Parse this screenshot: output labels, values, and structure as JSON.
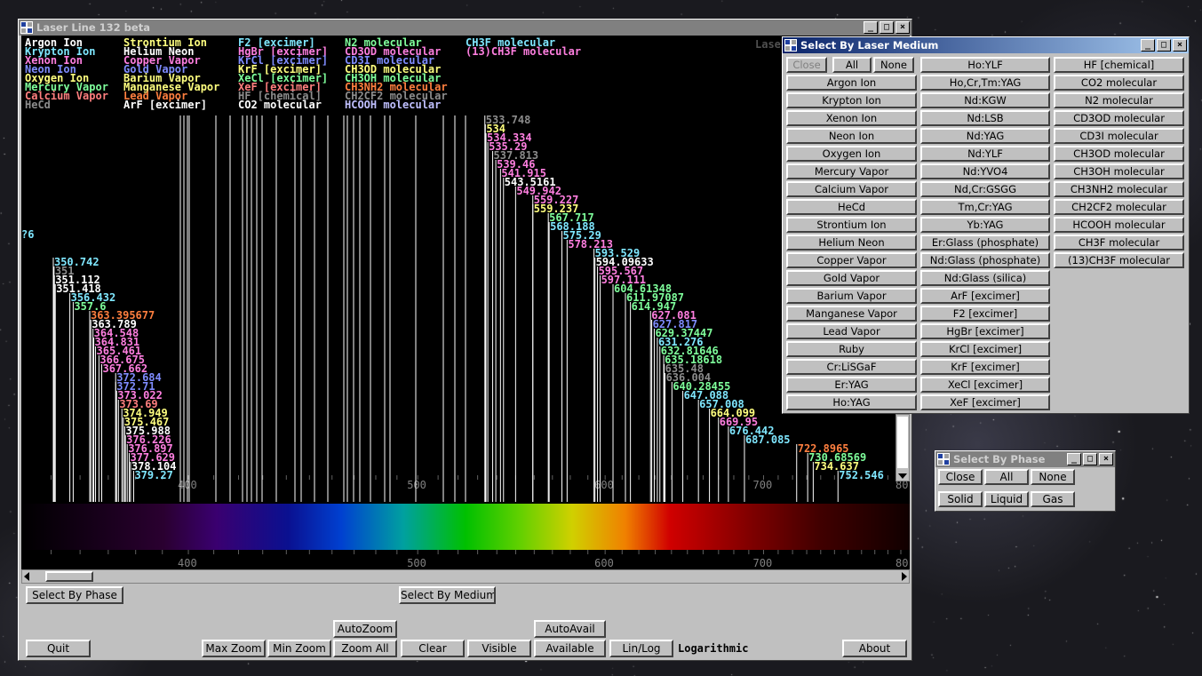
{
  "main_window": {
    "title": "Laser Line 132 beta",
    "watermark": "Laser"
  },
  "legend": [
    {
      "label": "Argon Ion",
      "color": "#ffffff"
    },
    {
      "label": "Krypton Ion",
      "color": "#7fe7ff"
    },
    {
      "label": "Xenon Ion",
      "color": "#ff7fe0"
    },
    {
      "label": "Neon Ion",
      "color": "#7f8cff"
    },
    {
      "label": "Oxygen Ion",
      "color": "#ffff7f"
    },
    {
      "label": "Mercury Vapor",
      "color": "#7fff9c"
    },
    {
      "label": "Calcium Vapor",
      "color": "#ff7f7f"
    },
    {
      "label": "HeCd",
      "color": "#8c8c8c"
    },
    {
      "label": "Strontium Ion",
      "color": "#ffff7f"
    },
    {
      "label": "Helium Neon",
      "color": "#ffffff"
    },
    {
      "label": "Copper Vapor",
      "color": "#ff7fe0"
    },
    {
      "label": "Gold Vapor",
      "color": "#7f8cff"
    },
    {
      "label": "Barium Vapor",
      "color": "#ffff7f"
    },
    {
      "label": "Manganese Vapor",
      "color": "#ffff7f"
    },
    {
      "label": "Lead Vapor",
      "color": "#ff7f3f"
    },
    {
      "label": "ArF [excimer]",
      "color": "#ffffff"
    },
    {
      "label": "F2 [excimer]",
      "color": "#7fe7ff"
    },
    {
      "label": "HgBr [excimer]",
      "color": "#ff7fe0"
    },
    {
      "label": "KrCl [excimer]",
      "color": "#7f8cff"
    },
    {
      "label": "KrF [excimer]",
      "color": "#ffff7f"
    },
    {
      "label": "XeCl [excimer]",
      "color": "#7fff9c"
    },
    {
      "label": "XeF [excimer]",
      "color": "#ff7f7f"
    },
    {
      "label": "HF [chemical]",
      "color": "#8c8c8c"
    },
    {
      "label": "CO2 molecular",
      "color": "#ffffff"
    },
    {
      "label": "N2 molecular",
      "color": "#7fff9c"
    },
    {
      "label": "CD3OD molecular",
      "color": "#ff7fe0"
    },
    {
      "label": "CD3I molecular",
      "color": "#7f8cff"
    },
    {
      "label": "CH3OD molecular",
      "color": "#ffff7f"
    },
    {
      "label": "CH3OH molecular",
      "color": "#7fff9c"
    },
    {
      "label": "CH3NH2 molecular",
      "color": "#ff7f3f"
    },
    {
      "label": "CH2CF2 molecular",
      "color": "#8c8c8c"
    },
    {
      "label": "HCOOH molecular",
      "color": "#c0c0ff"
    },
    {
      "label": "CH3F molecular",
      "color": "#7fe7ff"
    },
    {
      "label": "(13)CH3F molecular",
      "color": "#ff7fe0"
    }
  ],
  "axis_ticks": [
    "400",
    "500",
    "600",
    "700",
    "80"
  ],
  "spectrum_lines": [
    {
      "wl": "350.742",
      "c": "#7fe7ff"
    },
    {
      "wl": "351",
      "c": "#8c8c8c"
    },
    {
      "wl": "351.112",
      "c": "#ffffff"
    },
    {
      "wl": "351.418",
      "c": "#ffffff"
    },
    {
      "wl": "356.432",
      "c": "#7fe7ff"
    },
    {
      "wl": "357.6",
      "c": "#7fff9c"
    },
    {
      "wl": "363.395677",
      "c": "#ff7f3f"
    },
    {
      "wl": "363.789",
      "c": "#ffffff"
    },
    {
      "wl": "364.548",
      "c": "#ff7fe0"
    },
    {
      "wl": "364.831",
      "c": "#ff7fe0"
    },
    {
      "wl": "365.461",
      "c": "#ff7fe0"
    },
    {
      "wl": "366.675",
      "c": "#ff7fe0"
    },
    {
      "wl": "367.662",
      "c": "#ff7fe0"
    },
    {
      "wl": "372.684",
      "c": "#7f8cff"
    },
    {
      "wl": "372.71",
      "c": "#7f8cff"
    },
    {
      "wl": "373.022",
      "c": "#ff7fe0"
    },
    {
      "wl": "373.69",
      "c": "#ff7f7f"
    },
    {
      "wl": "374.949",
      "c": "#ffff7f"
    },
    {
      "wl": "375.467",
      "c": "#ffff7f"
    },
    {
      "wl": "375.988",
      "c": "#ffffff"
    },
    {
      "wl": "376.226",
      "c": "#ff7fe0"
    },
    {
      "wl": "376.897",
      "c": "#ff7fe0"
    },
    {
      "wl": "377.629",
      "c": "#ff7fe0"
    },
    {
      "wl": "378.104",
      "c": "#ffffff"
    },
    {
      "wl": "379.27",
      "c": "#7fe7ff"
    },
    {
      "wl": "533.748",
      "c": "#8c8c8c"
    },
    {
      "wl": "534",
      "c": "#ffff7f"
    },
    {
      "wl": "534.334",
      "c": "#ff7fe0"
    },
    {
      "wl": "535.29",
      "c": "#ff7fe0"
    },
    {
      "wl": "537.813",
      "c": "#8c8c8c"
    },
    {
      "wl": "539.46",
      "c": "#ff7fe0"
    },
    {
      "wl": "541.915",
      "c": "#ff7fe0"
    },
    {
      "wl": "543.5161",
      "c": "#ffffff"
    },
    {
      "wl": "549.942",
      "c": "#ff7fe0"
    },
    {
      "wl": "559.227",
      "c": "#ff7fe0"
    },
    {
      "wl": "559.237",
      "c": "#ffff7f"
    },
    {
      "wl": "567.717",
      "c": "#7fff9c"
    },
    {
      "wl": "568.188",
      "c": "#7fe7ff"
    },
    {
      "wl": "575.29",
      "c": "#7fe7ff"
    },
    {
      "wl": "578.213",
      "c": "#ff7fe0"
    },
    {
      "wl": "593.529",
      "c": "#7fe7ff"
    },
    {
      "wl": "594.09633",
      "c": "#ffffff"
    },
    {
      "wl": "595.567",
      "c": "#ff7fe0"
    },
    {
      "wl": "597.111",
      "c": "#ff7fe0"
    },
    {
      "wl": "604.61348",
      "c": "#7fff9c"
    },
    {
      "wl": "611.97087",
      "c": "#7fff9c"
    },
    {
      "wl": "614.947",
      "c": "#7fff9c"
    },
    {
      "wl": "627.081",
      "c": "#ff7fe0"
    },
    {
      "wl": "627.817",
      "c": "#7f8cff"
    },
    {
      "wl": "629.37447",
      "c": "#7fff9c"
    },
    {
      "wl": "631.276",
      "c": "#7fe7ff"
    },
    {
      "wl": "632.81646",
      "c": "#7fff9c"
    },
    {
      "wl": "635.18618",
      "c": "#7fff9c"
    },
    {
      "wl": "635.48",
      "c": "#8c8c8c"
    },
    {
      "wl": "636.004",
      "c": "#8c8c8c"
    },
    {
      "wl": "640.28455",
      "c": "#7fff9c"
    },
    {
      "wl": "647.088",
      "c": "#7fe7ff"
    },
    {
      "wl": "657.008",
      "c": "#7fe7ff"
    },
    {
      "wl": "664.099",
      "c": "#ffff7f"
    },
    {
      "wl": "669.95",
      "c": "#ff7fe0"
    },
    {
      "wl": "676.442",
      "c": "#7fe7ff"
    },
    {
      "wl": "687.085",
      "c": "#7fe7ff"
    },
    {
      "wl": "722.8965",
      "c": "#ff7f3f"
    },
    {
      "wl": "730.68569",
      "c": "#7fff9c"
    },
    {
      "wl": "734.637",
      "c": "#ffff7f"
    },
    {
      "wl": "752.546",
      "c": "#7fe7ff"
    }
  ],
  "left_edge_label": "?6",
  "scale_mode": "Logarithmic",
  "buttons": {
    "select_by_phase": "Select By Phase",
    "select_by_medium": "Select By Medium",
    "autozoom": "AutoZoom",
    "autoavail": "AutoAvail",
    "quit": "Quit",
    "max_zoom": "Max Zoom",
    "min_zoom": "Min Zoom",
    "zoom_all": "Zoom All",
    "clear": "Clear",
    "visible": "Visible",
    "available": "Available",
    "lin_log": "Lin/Log",
    "about": "About"
  },
  "medium_window": {
    "title": "Select By Laser Medium",
    "col1": [
      "Close",
      "All",
      "None",
      "Argon Ion",
      "Krypton Ion",
      "Xenon Ion",
      "Neon Ion",
      "Oxygen Ion",
      "Mercury Vapor",
      "Calcium Vapor",
      "HeCd",
      "Strontium Ion",
      "Helium Neon",
      "Copper Vapor",
      "Gold Vapor",
      "Barium Vapor",
      "Manganese Vapor",
      "Lead Vapor",
      "Ruby",
      "Cr:LiSGaF",
      "Er:YAG",
      "Ho:YAG"
    ],
    "col2": [
      "Ho:YLF",
      "Ho,Cr,Tm:YAG",
      "Nd:KGW",
      "Nd:LSB",
      "Nd:YAG",
      "Nd:YLF",
      "Nd:YVO4",
      "Nd,Cr:GSGG",
      "Tm,Cr:YAG",
      "Yb:YAG",
      "Er:Glass (phosphate)",
      "Nd:Glass (phosphate)",
      "Nd:Glass (silica)",
      "ArF [excimer]",
      "F2 [excimer]",
      "HgBr [excimer]",
      "KrCl [excimer]",
      "KrF [excimer]",
      "XeCl [excimer]",
      "XeF [excimer]"
    ],
    "col3": [
      "HF [chemical]",
      "CO2 molecular",
      "N2 molecular",
      "CD3OD molecular",
      "CD3I molecular",
      "CH3OD molecular",
      "CH3OH molecular",
      "CH3NH2 molecular",
      "CH2CF2 molecular",
      "HCOOH molecular",
      "CH3F molecular",
      "(13)CH3F molecular"
    ]
  },
  "phase_window": {
    "title": "Select By Phase",
    "buttons": [
      "Close",
      "All",
      "None",
      "Solid",
      "Liquid",
      "Gas"
    ]
  }
}
